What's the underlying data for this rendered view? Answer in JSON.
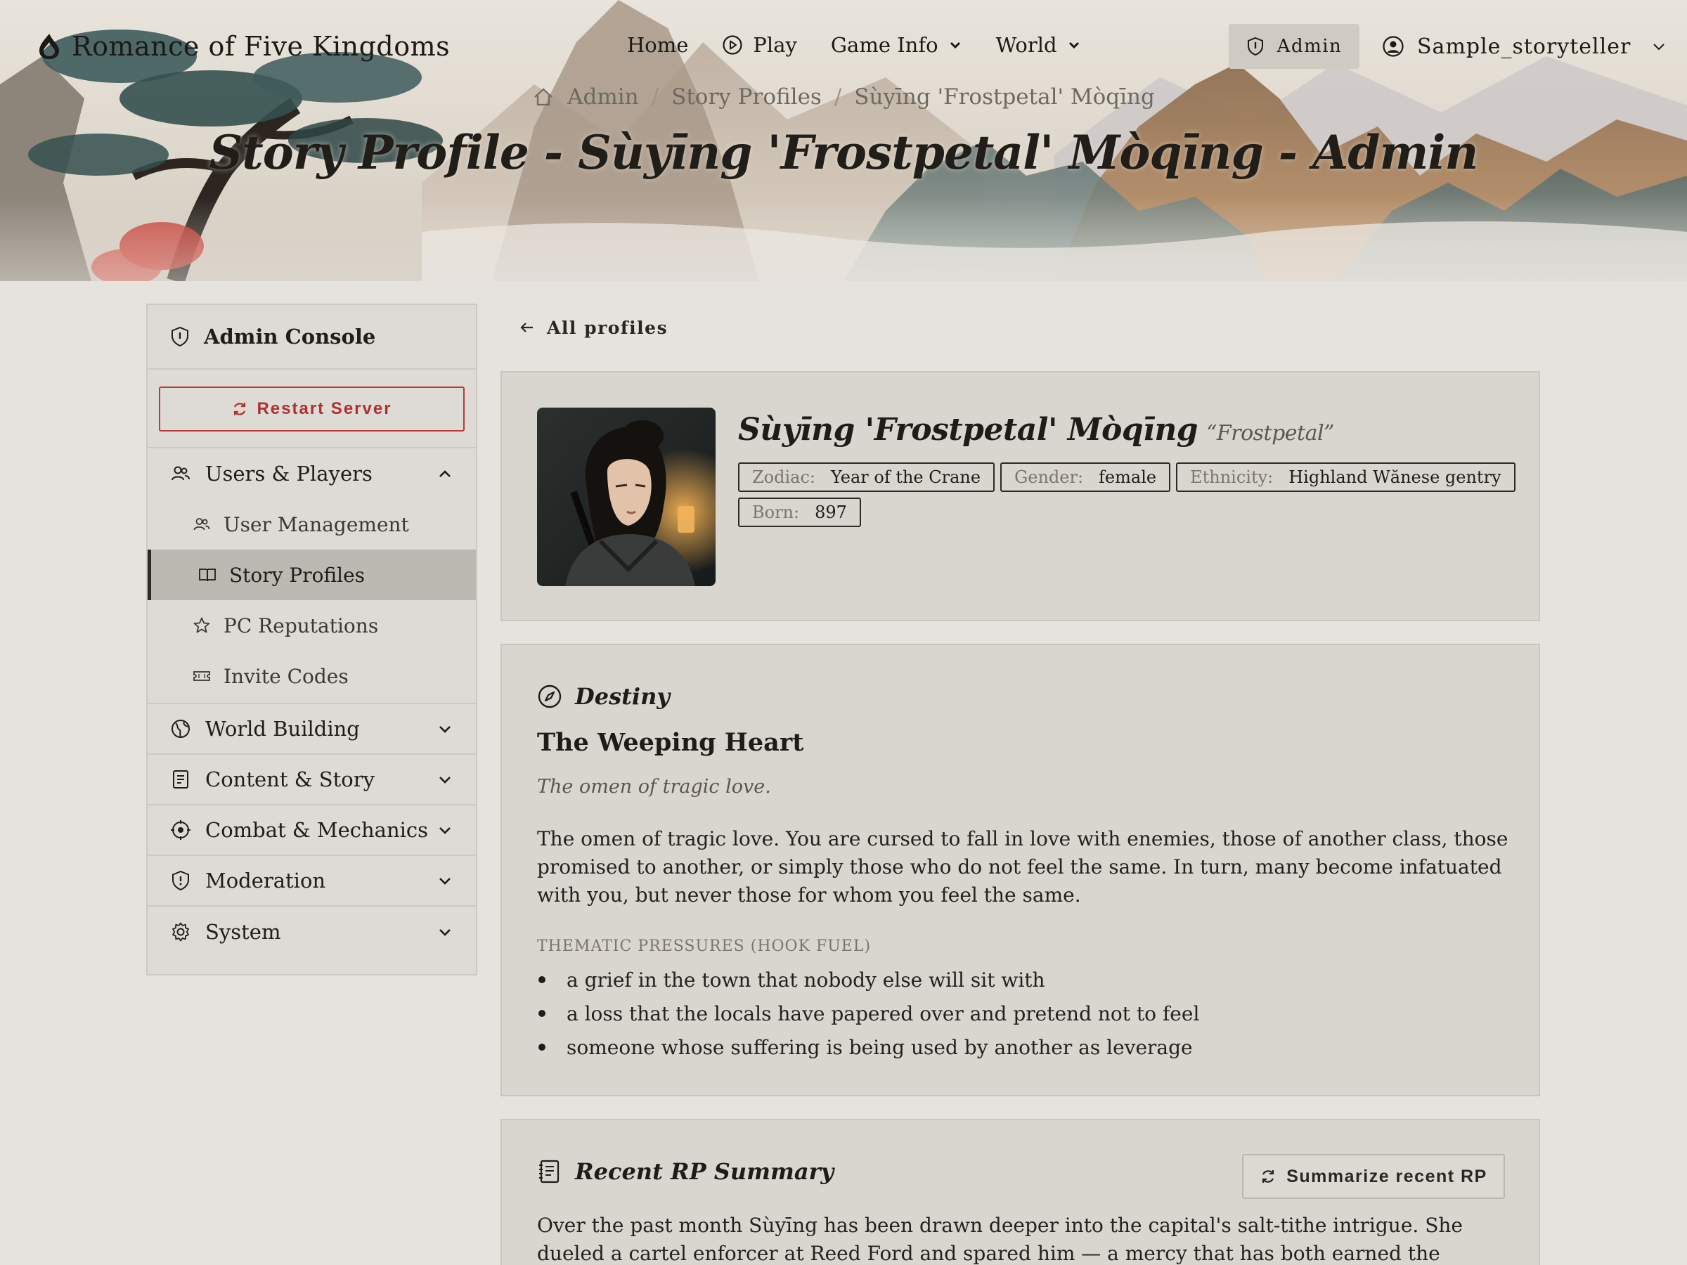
{
  "app": {
    "brand": "Romance of Five Kingdoms"
  },
  "nav": {
    "home": "Home",
    "play": "Play",
    "game_info": "Game Info",
    "world": "World",
    "admin": "Admin",
    "user": "Sample_storyteller"
  },
  "breadcrumb": {
    "items": [
      "Admin",
      "Story Profiles",
      "Sùyīng 'Frostpetal' Mòqīng"
    ]
  },
  "page": {
    "title": "Story Profile - Sùyīng 'Frostpetal' Mòqīng - Admin"
  },
  "sidebar": {
    "header": "Admin Console",
    "restart": "Restart Server",
    "groups": [
      {
        "label": "Users & Players",
        "expanded": true,
        "items": [
          "User Management",
          "Story Profiles",
          "PC Reputations",
          "Invite Codes"
        ]
      },
      {
        "label": "World Building"
      },
      {
        "label": "Content & Story"
      },
      {
        "label": "Combat & Mechanics"
      },
      {
        "label": "Moderation"
      },
      {
        "label": "System"
      }
    ]
  },
  "main": {
    "back": "All profiles",
    "profile": {
      "name": "Sùyīng 'Frostpetal' Mòqīng",
      "nickname": "“Frostpetal”",
      "tags": [
        {
          "k": "Zodiac:",
          "v": "Year of the Crane"
        },
        {
          "k": "Gender:",
          "v": "female"
        },
        {
          "k": "Ethnicity:",
          "v": "Highland Wănese gentry"
        },
        {
          "k": "Born:",
          "v": "897"
        }
      ]
    },
    "destiny": {
      "heading": "Destiny",
      "name": "The Weeping Heart",
      "omen": "The omen of tragic love.",
      "description": "The omen of tragic love. You are cursed to fall in love with enemies, those of another class, those promised to another, or simply those who do not feel the same. In turn, many become infatuated with you, but never those for whom you feel the same.",
      "pressures_label": "THEMATIC PRESSURES (HOOK FUEL)",
      "pressures": [
        "a grief in the town that nobody else will sit with",
        "a loss that the locals have papered over and pretend not to feel",
        "someone whose suffering is being used by another as leverage"
      ]
    },
    "summary": {
      "heading": "Recent RP Summary",
      "button": "Summarize recent RP",
      "text": "Over the past month Sùyīng has been drawn deeper into the capital's salt-tithe intrigue. She dueled a cartel enforcer at Reed Ford and spared him — a mercy that has both earned the governor's quiet"
    }
  },
  "colors": {
    "accent_red": "#b0302e",
    "background": "#e6e3de",
    "card": "#d9d5cf",
    "active_item": "#bcb8b2"
  }
}
